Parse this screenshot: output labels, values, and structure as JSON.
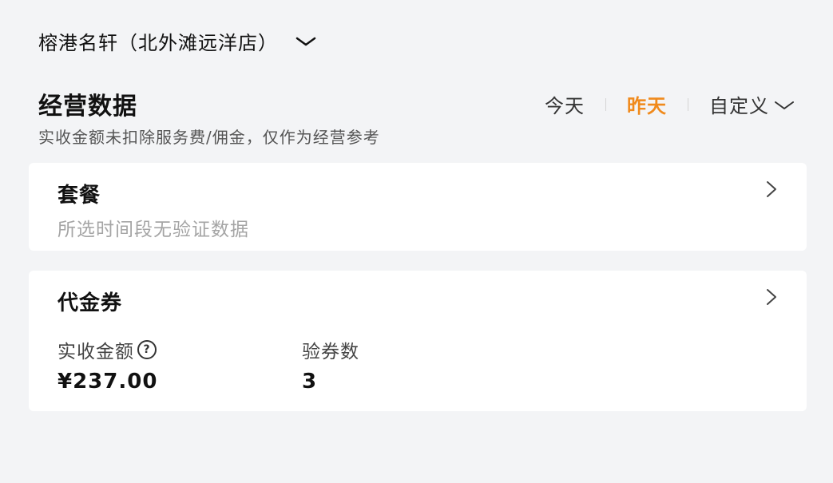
{
  "store": {
    "name": "榕港名轩（北外滩远洋店）",
    "chevron_icon": "chevron-down-icon"
  },
  "header": {
    "title": "经营数据",
    "subtitle": "实收金额未扣除服务费/佣金，仅作为经营参考"
  },
  "date_tabs": {
    "items": [
      "今天",
      "昨天",
      "自定义"
    ],
    "active": "昨天",
    "active_color": "#f08a1c"
  },
  "cards": [
    {
      "title": "套餐",
      "empty_text": "所选时间段无验证数据",
      "arrow_icon": "chevron-right-icon"
    },
    {
      "title": "代金券",
      "arrow_icon": "chevron-right-icon",
      "metrics": [
        {
          "label": "实收金额",
          "value": "¥237.00",
          "help_icon": "question-circle-icon"
        },
        {
          "label": "验券数",
          "value": "3"
        }
      ]
    }
  ]
}
